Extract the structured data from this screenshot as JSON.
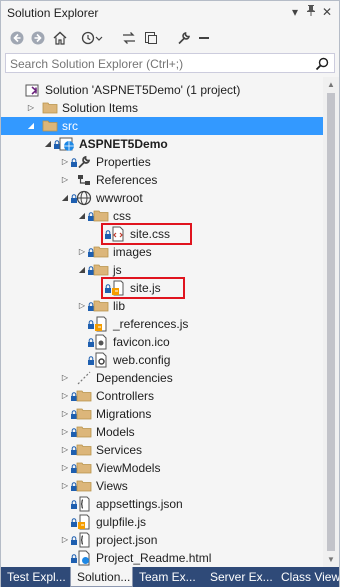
{
  "window": {
    "title": "Solution Explorer"
  },
  "search": {
    "placeholder": "Search Solution Explorer (Ctrl+;)"
  },
  "tree": [
    {
      "label": "Solution 'ASPNET5Demo' (1 project)",
      "icon": "solution-icon",
      "expander": "none",
      "bold": false,
      "selected": false,
      "locked": false,
      "highlighted": false,
      "depth": 0
    },
    {
      "label": "Solution Items",
      "icon": "folder-icon",
      "expander": "collapsed",
      "bold": false,
      "selected": false,
      "locked": false,
      "highlighted": false,
      "depth": 1
    },
    {
      "label": "src",
      "icon": "folder-icon",
      "expander": "expanded",
      "bold": false,
      "selected": true,
      "locked": false,
      "highlighted": false,
      "depth": 1
    },
    {
      "label": "ASPNET5Demo",
      "icon": "web-project-icon",
      "expander": "expanded",
      "bold": true,
      "selected": false,
      "locked": true,
      "highlighted": false,
      "depth": 2
    },
    {
      "label": "Properties",
      "icon": "wrench-icon",
      "expander": "collapsed",
      "bold": false,
      "selected": false,
      "locked": true,
      "highlighted": false,
      "depth": 3
    },
    {
      "label": "References",
      "icon": "references-icon",
      "expander": "collapsed",
      "bold": false,
      "selected": false,
      "locked": false,
      "highlighted": false,
      "depth": 3
    },
    {
      "label": "wwwroot",
      "icon": "globe-icon",
      "expander": "expanded",
      "bold": false,
      "selected": false,
      "locked": true,
      "highlighted": false,
      "depth": 3
    },
    {
      "label": "css",
      "icon": "folder-icon",
      "expander": "expanded",
      "bold": false,
      "selected": false,
      "locked": true,
      "highlighted": false,
      "depth": 4
    },
    {
      "label": "site.css",
      "icon": "css-file-icon",
      "expander": "none",
      "bold": false,
      "selected": false,
      "locked": true,
      "highlighted": true,
      "depth": 5
    },
    {
      "label": "images",
      "icon": "folder-icon",
      "expander": "collapsed",
      "bold": false,
      "selected": false,
      "locked": true,
      "highlighted": false,
      "depth": 4
    },
    {
      "label": "js",
      "icon": "folder-icon",
      "expander": "expanded",
      "bold": false,
      "selected": false,
      "locked": true,
      "highlighted": false,
      "depth": 4
    },
    {
      "label": "site.js",
      "icon": "js-file-icon",
      "expander": "none",
      "bold": false,
      "selected": false,
      "locked": true,
      "highlighted": true,
      "depth": 5
    },
    {
      "label": "lib",
      "icon": "folder-icon",
      "expander": "collapsed",
      "bold": false,
      "selected": false,
      "locked": true,
      "highlighted": false,
      "depth": 4
    },
    {
      "label": "_references.js",
      "icon": "js-file-icon",
      "expander": "none",
      "bold": false,
      "selected": false,
      "locked": true,
      "highlighted": false,
      "depth": 4
    },
    {
      "label": "favicon.ico",
      "icon": "ico-file-icon",
      "expander": "none",
      "bold": false,
      "selected": false,
      "locked": true,
      "highlighted": false,
      "depth": 4
    },
    {
      "label": "web.config",
      "icon": "config-file-icon",
      "expander": "none",
      "bold": false,
      "selected": false,
      "locked": true,
      "highlighted": false,
      "depth": 4
    },
    {
      "label": "Dependencies",
      "icon": "dependencies-icon",
      "expander": "collapsed",
      "bold": false,
      "selected": false,
      "locked": false,
      "highlighted": false,
      "depth": 3
    },
    {
      "label": "Controllers",
      "icon": "folder-icon",
      "expander": "collapsed",
      "bold": false,
      "selected": false,
      "locked": true,
      "highlighted": false,
      "depth": 3
    },
    {
      "label": "Migrations",
      "icon": "folder-icon",
      "expander": "collapsed",
      "bold": false,
      "selected": false,
      "locked": true,
      "highlighted": false,
      "depth": 3
    },
    {
      "label": "Models",
      "icon": "folder-icon",
      "expander": "collapsed",
      "bold": false,
      "selected": false,
      "locked": true,
      "highlighted": false,
      "depth": 3
    },
    {
      "label": "Services",
      "icon": "folder-icon",
      "expander": "collapsed",
      "bold": false,
      "selected": false,
      "locked": true,
      "highlighted": false,
      "depth": 3
    },
    {
      "label": "ViewModels",
      "icon": "folder-icon",
      "expander": "collapsed",
      "bold": false,
      "selected": false,
      "locked": true,
      "highlighted": false,
      "depth": 3
    },
    {
      "label": "Views",
      "icon": "folder-icon",
      "expander": "collapsed",
      "bold": false,
      "selected": false,
      "locked": true,
      "highlighted": false,
      "depth": 3
    },
    {
      "label": "appsettings.json",
      "icon": "json-file-icon",
      "expander": "none",
      "bold": false,
      "selected": false,
      "locked": true,
      "highlighted": false,
      "depth": 3
    },
    {
      "label": "gulpfile.js",
      "icon": "js-file-icon",
      "expander": "none",
      "bold": false,
      "selected": false,
      "locked": true,
      "highlighted": false,
      "depth": 3
    },
    {
      "label": "project.json",
      "icon": "json-file-icon",
      "expander": "collapsed",
      "bold": false,
      "selected": false,
      "locked": true,
      "highlighted": false,
      "depth": 3
    },
    {
      "label": "Project_Readme.html",
      "icon": "html-file-icon",
      "expander": "none",
      "bold": false,
      "selected": false,
      "locked": true,
      "highlighted": false,
      "depth": 3
    }
  ],
  "tabs": [
    {
      "label": "Test Expl...",
      "active": false
    },
    {
      "label": "Solution...",
      "active": true
    },
    {
      "label": "Team Ex...",
      "active": false
    },
    {
      "label": "Server Ex...",
      "active": false
    },
    {
      "label": "Class View",
      "active": false
    }
  ],
  "colors": {
    "selection": "#3399ff",
    "highlight_box": "#e0141e",
    "tab_strip": "#2f4a78",
    "lock": "#1e5fb0"
  }
}
